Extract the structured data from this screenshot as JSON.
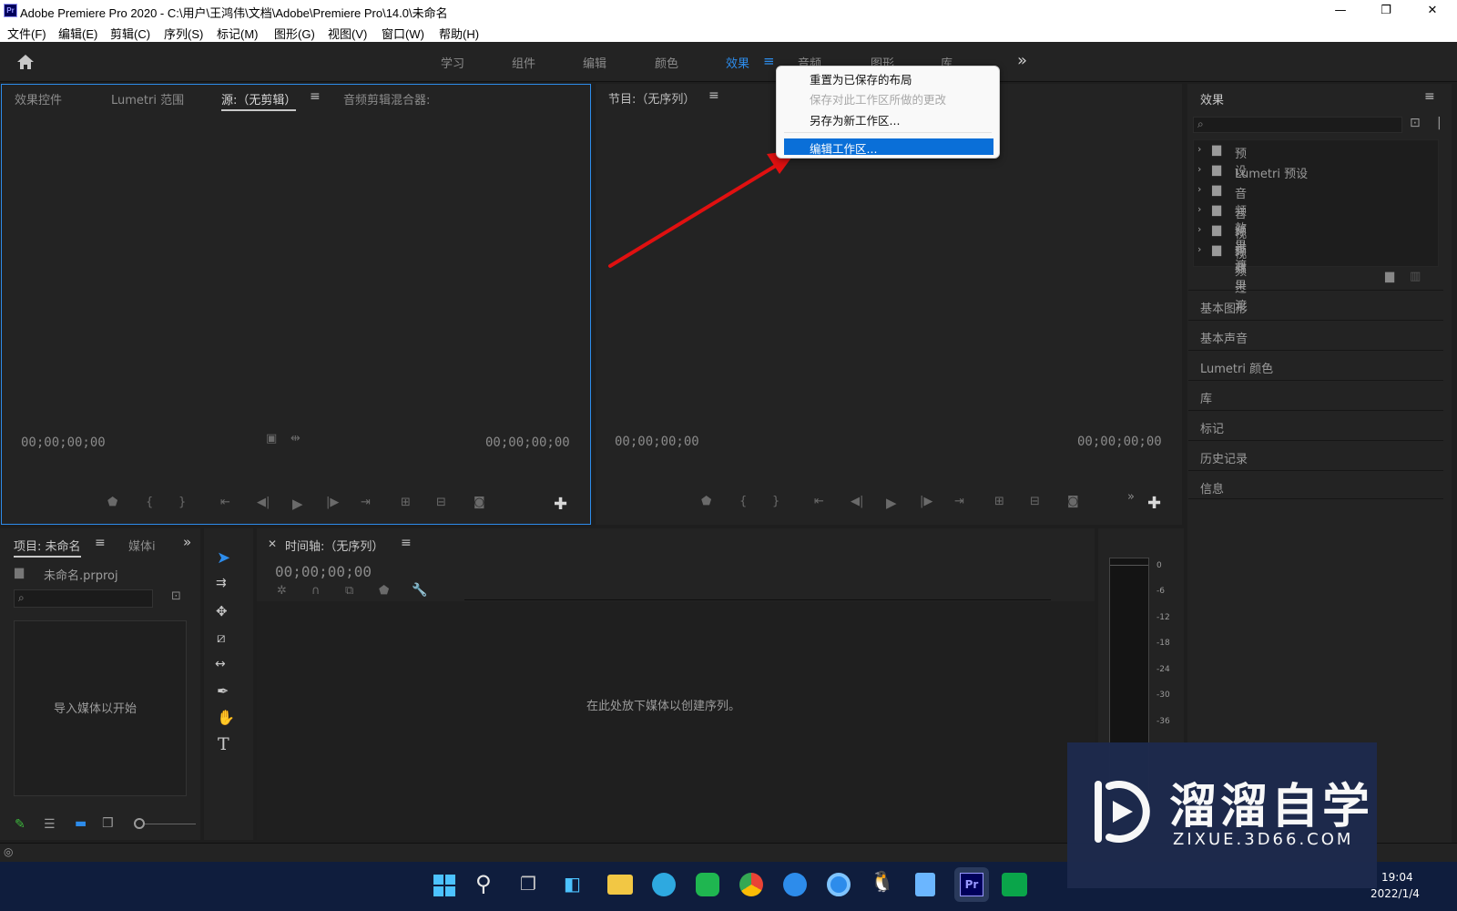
{
  "window": {
    "title": "Adobe Premiere Pro 2020 - C:\\用户\\王鸿伟\\文档\\Adobe\\Premiere Pro\\14.0\\未命名",
    "logo": "Pr",
    "controls": {
      "minimize": "—",
      "maximize": "❐",
      "close": "✕"
    }
  },
  "menu": [
    "文件(F)",
    "编辑(E)",
    "剪辑(C)",
    "序列(S)",
    "标记(M)",
    "图形(G)",
    "视图(V)",
    "窗口(W)",
    "帮助(H)"
  ],
  "workspaces": {
    "tabs": [
      "学习",
      "组件",
      "编辑",
      "颜色",
      "效果",
      "音频",
      "图形",
      "库"
    ],
    "active": "效果",
    "overflow": "»"
  },
  "context_menu": {
    "items": [
      {
        "label": "重置为已保存的布局",
        "enabled": true
      },
      {
        "label": "保存对此工作区所做的更改",
        "enabled": false
      },
      {
        "label": "另存为新工作区...",
        "enabled": true
      },
      {
        "label": "编辑工作区...",
        "enabled": true,
        "highlighted": true
      }
    ]
  },
  "source_panel": {
    "tabs": [
      "效果控件",
      "Lumetri 范围",
      "源:（无剪辑）",
      "音频剪辑混合器:"
    ],
    "active_tab": "源:（无剪辑）",
    "timecode_left": "00;00;00;00",
    "timecode_right": "00;00;00;00"
  },
  "program_panel": {
    "title": "节目:（无序列）",
    "timecode_left": "00;00;00;00",
    "timecode_right": "00;00;00;00"
  },
  "effects_panel": {
    "title": "效果",
    "tree": [
      "预设",
      "Lumetri 预设",
      "音频效果",
      "音频过渡",
      "视频效果",
      "视频过渡"
    ],
    "sections": [
      "基本图形",
      "基本声音",
      "Lumetri 颜色",
      "库",
      "标记",
      "历史记录",
      "信息"
    ]
  },
  "project_panel": {
    "tabs": [
      "项目: 未命名",
      "媒体i"
    ],
    "file": "未命名.prproj",
    "empty_text": "导入媒体以开始"
  },
  "timeline_panel": {
    "title": "时间轴:（无序列）",
    "timecode": "00;00;00;00",
    "empty_text": "在此处放下媒体以创建序列。"
  },
  "audio_meter": {
    "ticks": [
      "0",
      "-6",
      "-12",
      "-18",
      "-24",
      "-30",
      "-36"
    ]
  },
  "taskbar": {
    "time": "19:04",
    "date": "2022/1/4"
  },
  "watermark": {
    "name": "溜溜自学",
    "url": "ZIXUE.3D66.COM"
  },
  "colors": {
    "accent": "#2d8ceb",
    "menu_highlight": "#0a6fd8",
    "annotation_arrow": "#e01010"
  }
}
